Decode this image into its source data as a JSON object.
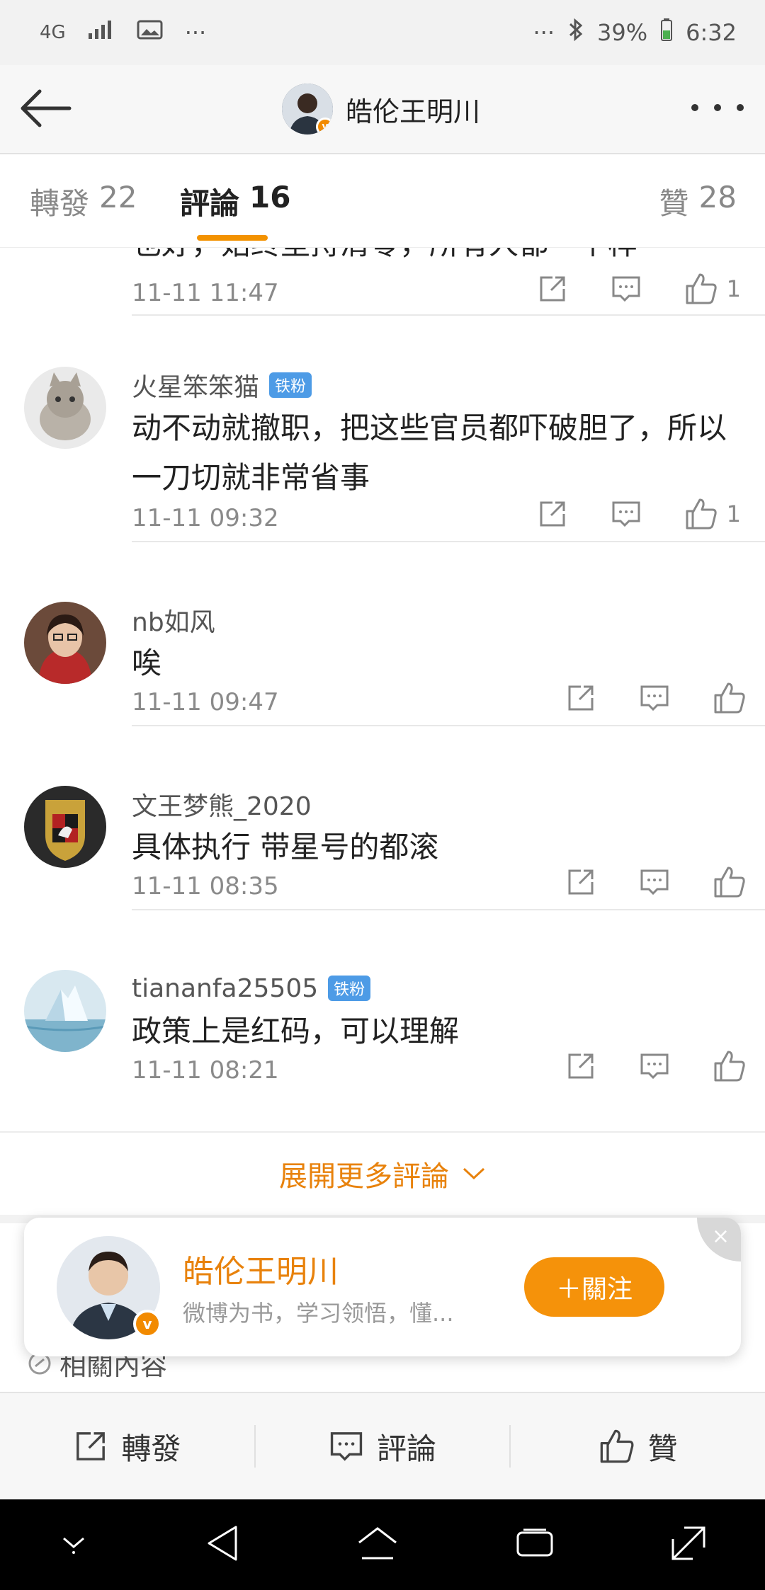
{
  "status_bar": {
    "network": "4G",
    "more": "···",
    "battery": "39%",
    "time": "6:32"
  },
  "header": {
    "title": "皓伦王明川"
  },
  "tabs": {
    "repost_label": "轉發",
    "repost_count": "22",
    "comment_label": "評論",
    "comment_count": "16",
    "like_label": "贊",
    "like_count": "28"
  },
  "comments": [
    {
      "name": "",
      "badge": "",
      "text": "也好，始终坚持清零，所有人都一个样",
      "time": "11-11 11:47",
      "likes": "1"
    },
    {
      "name": "火星笨笨猫",
      "badge": "铁粉",
      "text": "动不动就撤职，把这些官员都吓破胆了，所以一刀切就非常省事",
      "time": "11-11 09:32",
      "likes": "1"
    },
    {
      "name": "nb如风",
      "badge": "",
      "text": "唉",
      "time": "11-11 09:47",
      "likes": ""
    },
    {
      "name": "文王梦熊_2020",
      "badge": "",
      "text": "具体执行 带星号的都滚",
      "time": "11-11 08:35",
      "likes": ""
    },
    {
      "name": "tiananfa25505",
      "badge": "铁粉",
      "text": "政策上是红码，可以理解",
      "time": "11-11 08:21",
      "likes": ""
    }
  ],
  "expand_more": "展開更多評論",
  "related": {
    "title": "相關內容"
  },
  "follow_card": {
    "name": "皓伦王明川",
    "description": "微博为书，学习领悟，懂...",
    "follow_label": "＋關注",
    "close": "×"
  },
  "bottom_bar": {
    "repost": "轉發",
    "comment": "評論",
    "like": "贊"
  },
  "colors": {
    "accent": "#f39200",
    "badge": "#4d9be6",
    "vip": "#f28a00"
  }
}
